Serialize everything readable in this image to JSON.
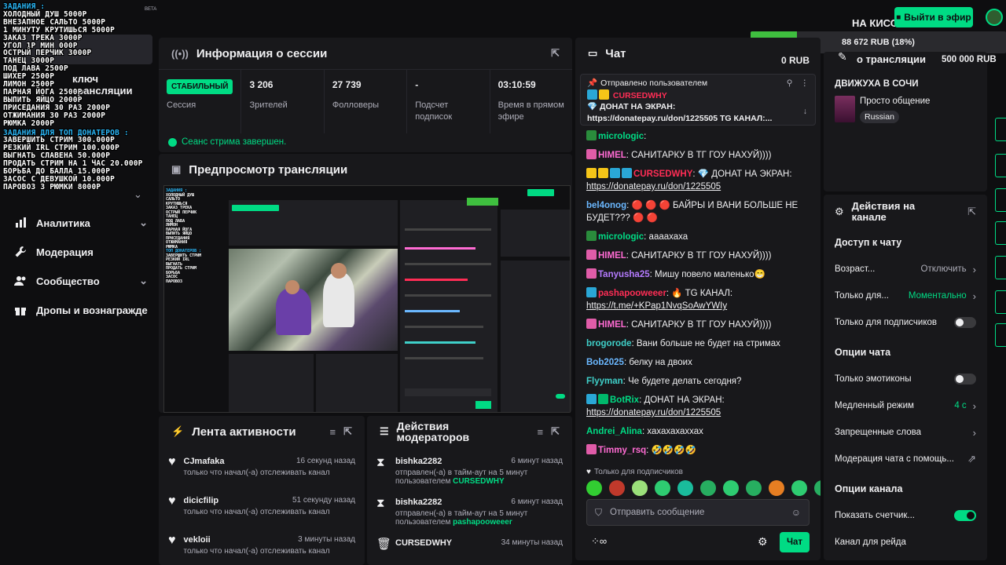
{
  "overlay": {
    "tasks_title": "ЗАДАНИЯ :",
    "tasks": [
      "ХОЛОДНЫЙ ДУШ 5000Р",
      "ВНЕЗАПНОЕ САЛЬТО 5000Р",
      "1 МИНУТУ КРУТИШЬСЯ 5000Р",
      "ЗАКАЗ ТРЕКА 3000Р",
      "УГОЛ 1Р МИН 000Р",
      "ОСТРЫЙ ПЕРЧИК 3000Р",
      "ТАНЕЦ 3000Р",
      "ПОД ЛАВА 2500Р",
      "ШИХЕР 2500Р",
      "ЛИМОН 2500Р",
      "ПАРНАЯ ЙОГА 2500Р",
      "ВЫПИТЬ ЯЙЦО 2000Р",
      "ПРИСЕДАНИЯ 30 РАЗ 2000Р",
      "ОТЖИМАНИЯ 30 РАЗ 2000Р",
      "РЮМКА 2000Р"
    ],
    "top_title": "ЗАДАНИЯ ДЛЯ ТОП ДОНАТЕРОВ :",
    "top_tasks": [
      "ЗАВЕРШИТЬ СТРИМ 300.000Р",
      "РЕЗКИЙ IRL СТРИМ 100.000Р",
      "ВЫГНАТЬ СЛАВЕНА 50.000Р",
      "ПРОДАТЬ СТРИМ НА 1 ЧАС 20.000Р",
      "БОРЬБА ДО БАЛЛА 15.000Р",
      "ЗАСОС С ДЕВУШКОЙ 10.000Р",
      "ПАРОВОЗ 3 РЮМКИ 8000Р"
    ]
  },
  "topbar": {
    "beta": "BETA",
    "streamer": "НА КИСОК",
    "go_live": "Выйти в эфир",
    "goal_text": "88 672 RUB (18%)",
    "goal_progress": 0.18
  },
  "sidebar": {
    "stream_key_partial": "ключ трансляции",
    "items": [
      {
        "label": "Аналитика",
        "icon": "chart-icon",
        "chevron": true
      },
      {
        "label": "Модерация",
        "icon": "wrench-icon",
        "chevron": false
      },
      {
        "label": "Сообщество",
        "icon": "people-icon",
        "chevron": true
      },
      {
        "label": "Дропы и вознаграждения",
        "icon": "gift-icon",
        "chevron": false
      }
    ]
  },
  "session": {
    "title": "Информация о сессии",
    "status_badge": "СТАБИЛЬНЫЙ",
    "status_label": "Сессия",
    "viewers": "3 206",
    "viewers_label": "Зрителей",
    "followers": "27 739",
    "followers_label": "Фолловеры",
    "subs": "-",
    "subs_label": "Подсчет подписок",
    "time": "03:10:59",
    "time_label": "Время в прямом эфире",
    "footer": "Сеанс стрима завершен."
  },
  "preview": {
    "title": "Предпросмотр трансляции"
  },
  "activity": {
    "title": "Лента активности",
    "items": [
      {
        "name": "CJmafaka",
        "time": "16 секунд назад",
        "text": "только что начал(-а) отслеживать канал"
      },
      {
        "name": "dicicfilip",
        "time": "51 секунду назад",
        "text": "только что начал(-а) отслеживать канал"
      },
      {
        "name": "vekloii",
        "time": "3 минуты назад",
        "text": "только что начал(-а) отслеживать канал"
      }
    ]
  },
  "mod_actions": {
    "title_line1": "Действия",
    "title_line2": "модераторов",
    "items": [
      {
        "name": "bishka2282",
        "time": "6 минут назад",
        "text": "отправлен(-а) в тайм-аут на 5 минут пользователем ",
        "target": "CURSEDWHY",
        "icon": "hourglass-icon"
      },
      {
        "name": "bishka2282",
        "time": "6 минут назад",
        "text": "отправлен(-а) в тайм-аут на 5 минут пользователем ",
        "target": "pashapooweeer",
        "icon": "hourglass-icon"
      },
      {
        "name": "CURSEDWHY",
        "time": "34 минуты назад",
        "text": "",
        "target": "",
        "icon": "trash-icon"
      }
    ]
  },
  "chat": {
    "title": "Чат",
    "rub": "0 RUB",
    "pinned_label": "Отправлено пользователем",
    "pinned_user": "CURSEDWHY",
    "pinned_text": "ДОНАТ НА ЭКРАН:",
    "pinned_link": "https://donatepay.ru/don/1225505",
    "pinned_tail": " TG КАНАЛ:...",
    "messages": [
      {
        "user": "micrologic",
        "color": "#00db84",
        "text": "",
        "link": "",
        "badges": [
          "#2a8c3c"
        ]
      },
      {
        "user": "HIMEL",
        "color": "#ff6bd3",
        "text": "САНИТАРКУ В ТГ ГОУ НАХУЙ))))",
        "link": "",
        "badges": [
          "#e05ca8"
        ]
      },
      {
        "user": "CURSEDWHY",
        "color": "#ff2d55",
        "text": "💎 ДОНАТ НА ЭКРАН:",
        "link": "https://donatepay.ru/don/1225505",
        "badges": [
          "#f5c518",
          "#f5c518",
          "#2aa7d6",
          "#2aa7d6"
        ]
      },
      {
        "user": "bel4onog",
        "color": "#6bb8ff",
        "text": "🔴 🔴 🔴 БАЙРЫ И ВАНИ БОЛЬШЕ НЕ БУДЕТ??? 🔴 🔴",
        "link": "",
        "badges": []
      },
      {
        "user": "micrologic",
        "color": "#00db84",
        "text": "аааахаха",
        "link": "",
        "badges": [
          "#2a8c3c"
        ]
      },
      {
        "user": "HIMEL",
        "color": "#ff6bd3",
        "text": "САНИТАРКУ В ТГ ГОУ НАХУЙ))))",
        "link": "",
        "badges": [
          "#e05ca8"
        ]
      },
      {
        "user": "Tanyusha25",
        "color": "#b57bff",
        "text": "Мишу повело маленько😁",
        "link": "",
        "badges": [
          "#e05ca8"
        ]
      },
      {
        "user": "pashapooweeer",
        "color": "#ff2d55",
        "text": "🔥 TG КАНАЛ:",
        "link": "https://t.me/+KPap1NvqSoAwYWIy",
        "badges": [
          "#2aa7d6"
        ]
      },
      {
        "user": "HIMEL",
        "color": "#ff6bd3",
        "text": "САНИТАРКУ В ТГ ГОУ НАХУЙ))))",
        "link": "",
        "badges": [
          "#e05ca8"
        ]
      },
      {
        "user": "brogorode",
        "color": "#3fd0c9",
        "text": "Вани больше не будет на стримах",
        "link": "",
        "badges": []
      },
      {
        "user": "Bob2025",
        "color": "#6bb8ff",
        "text": "белку на двоих",
        "link": "",
        "badges": []
      },
      {
        "user": "Flyyman",
        "color": "#3fd0c9",
        "text": "Че будете делать сегодня?",
        "link": "",
        "badges": []
      },
      {
        "user": "BotRix",
        "color": "#00db84",
        "text": "ДОНАТ НА ЭКРАН:",
        "link": "https://donatepay.ru/don/1225505",
        "badges": [
          "#2aa7d6",
          "#00b86b"
        ]
      },
      {
        "user": "Andrei_Alina",
        "color": "#00db84",
        "text": "хахахахаххах",
        "link": "",
        "badges": []
      },
      {
        "user": "Timmy_rsq",
        "color": "#ff6bd3",
        "text": "🤣🤣🤣🤣",
        "link": "",
        "badges": [
          "#e05ca8"
        ]
      }
    ],
    "subs_only": "Только для подписчиков",
    "placeholder": "Отправить сообщение",
    "send": "Чат",
    "emote_colors": [
      "#32cd32",
      "#c0392b",
      "#9be07a",
      "#2ecc71",
      "#1abc9c",
      "#27ae60",
      "#2ecc71",
      "#27ae60",
      "#e67e22",
      "#2ecc71",
      "#27ae60"
    ]
  },
  "stream_info": {
    "title_partial": "о трансляции",
    "goal_right": "500 000 RUB",
    "stream_title": "ДВИЖУХА В СОЧИ",
    "category": "Просто общение",
    "language": "Russian"
  },
  "channel_actions": {
    "title_line1": "Действия на",
    "title_line2": "канале",
    "chat_access": "Доступ к чату",
    "age": "Возраст...",
    "age_val": "Отключить",
    "followers_only": "Только для...",
    "followers_only_val": "Моментально",
    "subs_only": "Только для подписчиков",
    "chat_options": "Опции чата",
    "emotes_only": "Только эмотиконы",
    "slow_mode": "Медленный режим",
    "slow_val": "4 с",
    "banned_words": "Запрещенные слова",
    "moderation_help": "Модерация чата с помощь...",
    "channel_options": "Опции канала",
    "show_counter": "Показать счетчик...",
    "raid_channel": "Канал для рейда"
  }
}
